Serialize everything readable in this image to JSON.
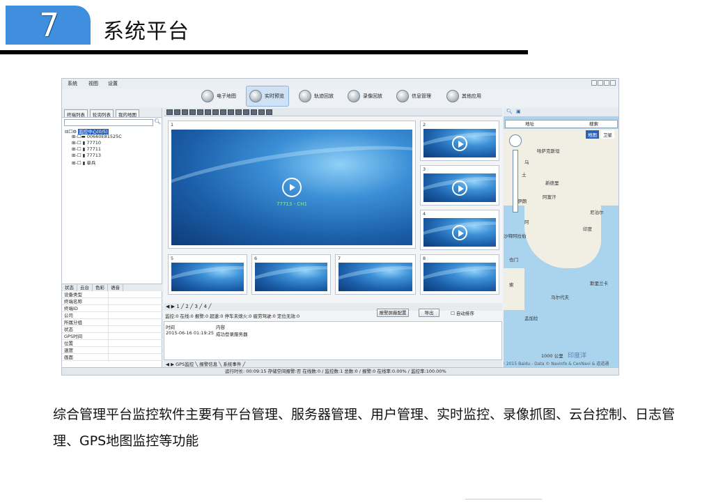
{
  "section": {
    "number": "7",
    "title": "系统平台"
  },
  "app": {
    "menu": [
      "系统",
      "视图",
      "设置"
    ],
    "toolbar": [
      {
        "label": "电子地图",
        "active": false
      },
      {
        "label": "实时预览",
        "active": true
      },
      {
        "label": "轨迹回放",
        "active": false
      },
      {
        "label": "录像回放",
        "active": false
      },
      {
        "label": "信息管理",
        "active": false
      },
      {
        "label": "其他应用",
        "active": false
      }
    ],
    "left_tabs": [
      "终端列表",
      "轮询列表",
      "我的地图"
    ],
    "tree": {
      "root": "监控中心(0/5)",
      "items": [
        "00660E81525C",
        "77710",
        "77711",
        "77713",
        "单兵"
      ]
    },
    "prop_tabs": [
      "状态",
      "云台",
      "色彩",
      "语音"
    ],
    "props": [
      "设备类型",
      "终端名称",
      "终端ID",
      "公司",
      "所属分组",
      "状态",
      "GPS时间",
      "位置",
      "速度",
      "画面"
    ],
    "tiles": [
      {
        "num": "1",
        "caption": "77713 - CH1"
      },
      {
        "num": "2",
        "caption": ""
      },
      {
        "num": "3",
        "caption": ""
      },
      {
        "num": "4",
        "caption": ""
      },
      {
        "num": "5",
        "caption": ""
      },
      {
        "num": "6",
        "caption": ""
      },
      {
        "num": "7",
        "caption": ""
      },
      {
        "num": "8",
        "caption": ""
      }
    ],
    "page_tabs": "1 ╱ 2 ╱ 3 ╱ 4 ╱",
    "alarm_filters": "监控:0 在线:0 报警:0 超速:0 停车未熄火:0 疲劳驾驶:0 定位无效:0",
    "alarm_buttons": {
      "set": "报警屏蔽配置",
      "export": "导出",
      "autosort": "自动排序"
    },
    "log": {
      "headers": [
        "时间",
        "内容"
      ],
      "rows": [
        [
          "2015-06-16 01:19:25",
          "成功登录服务器"
        ]
      ]
    },
    "bottom_tabs": "GPS监控 ╲ 报警信息 ╲ 系统事件 ╱",
    "map": {
      "address_label": "地址",
      "search_label": "搜索",
      "map_types": [
        "地图",
        "卫星"
      ],
      "places": [
        "哈萨克斯坦",
        "乌",
        "土",
        "伊朗",
        "阿富汗",
        "尼泊尔",
        "阿",
        "印度",
        "沙特阿拉伯",
        "也门",
        "索",
        "马尔代夫",
        "斯里兰卡",
        "孟加拉",
        "新德里"
      ],
      "scale": "1000 公里",
      "ocean": "印度洋",
      "copyright": "© 2015 Baidu - Data © Navinfo & CenNavi & 道道通"
    },
    "status": "运行时长: 00:09:15    存储空间报警:否    在线数:0 / 监控数:1    总数:0 / 报警:0    在线率:0.00% / 监控率:100.00%"
  },
  "description": "综合管理平台监控软件主要有平台管理、服务器管理、用户管理、实时监控、录像抓图、云台控制、日志管理、GPS地图监控等功能"
}
